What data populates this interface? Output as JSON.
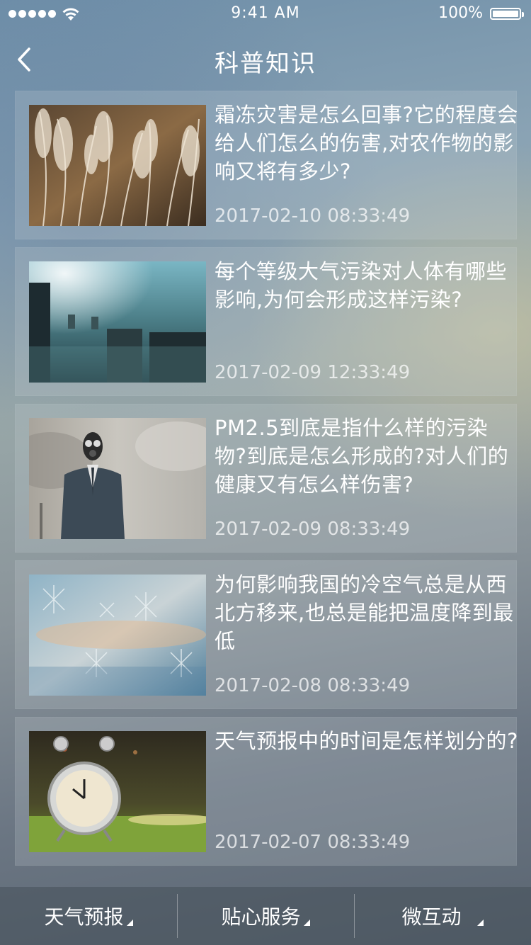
{
  "status_bar": {
    "time": "9:41 AM",
    "battery": "100%"
  },
  "nav": {
    "title": "科普知识"
  },
  "articles": [
    {
      "title": "霜冻灾害是怎么回事?它的程度会给人们怎么的伤害,对农作物的影响又将有多少?",
      "date": "2017-02-10  08:33:49"
    },
    {
      "title": "每个等级大气污染对人体有哪些影响,为何会形成这样污染?",
      "date": "2017-02-09  12:33:49"
    },
    {
      "title": "PM2.5到底是指什么样的污染物?到底是怎么形成的?对人们的健康又有怎么样伤害?",
      "date": "2017-02-09  08:33:49"
    },
    {
      "title": "为何影响我国的冷空气总是从西北方移来,也总是能把温度降到最低",
      "date": "2017-02-08  08:33:49"
    },
    {
      "title": "天气预报中的时间是怎样划分的?",
      "date": "2017-02-07  08:33:49"
    }
  ],
  "tabbar": {
    "tabs": [
      {
        "label": "天气预报"
      },
      {
        "label": "贴心服务"
      },
      {
        "label": "微互动"
      }
    ]
  }
}
